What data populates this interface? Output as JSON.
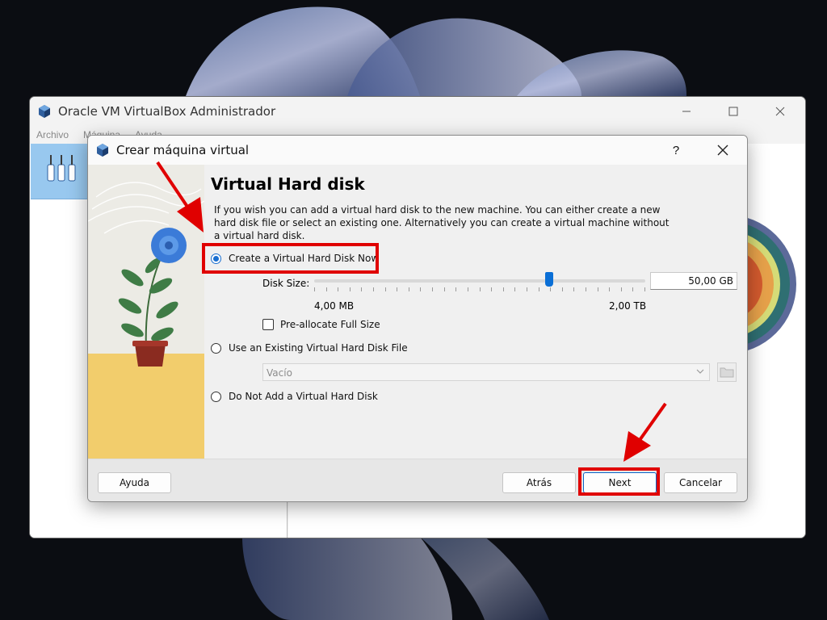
{
  "main_window": {
    "title": "Oracle VM VirtualBox Administrador",
    "menu": [
      "Archivo",
      "Máquina",
      "Ayuda"
    ]
  },
  "dialog": {
    "title": "Crear máquina virtual",
    "help_glyph": "?",
    "heading": "Virtual Hard disk",
    "description": "If you wish you can add a virtual hard disk to the new machine. You can either create a new hard disk file or select an existing one. Alternatively you can create a virtual machine without a virtual hard disk.",
    "options": {
      "create_now": {
        "label": "Create a Virtual Hard Disk Now",
        "selected": true
      },
      "use_existing": {
        "label": "Use an Existing Virtual Hard Disk File",
        "selected": false
      },
      "do_not_add": {
        "label": "Do Not Add a Virtual Hard Disk",
        "selected": false
      }
    },
    "disk_size": {
      "label": "Disk Size:",
      "value": "50,00 GB",
      "min_label": "4,00 MB",
      "max_label": "2,00 TB",
      "slider_fraction": 0.71
    },
    "preallocate": {
      "label": "Pre-allocate Full Size",
      "checked": false
    },
    "existing_file_combo": {
      "value": "Vacío",
      "enabled": false
    },
    "buttons": {
      "help": "Ayuda",
      "back": "Atrás",
      "next": "Next",
      "cancel": "Cancelar"
    }
  },
  "annotations": {
    "color": "#e00000"
  },
  "colors": {
    "accent": "#0a6fd6",
    "highlight": "#e00000"
  }
}
